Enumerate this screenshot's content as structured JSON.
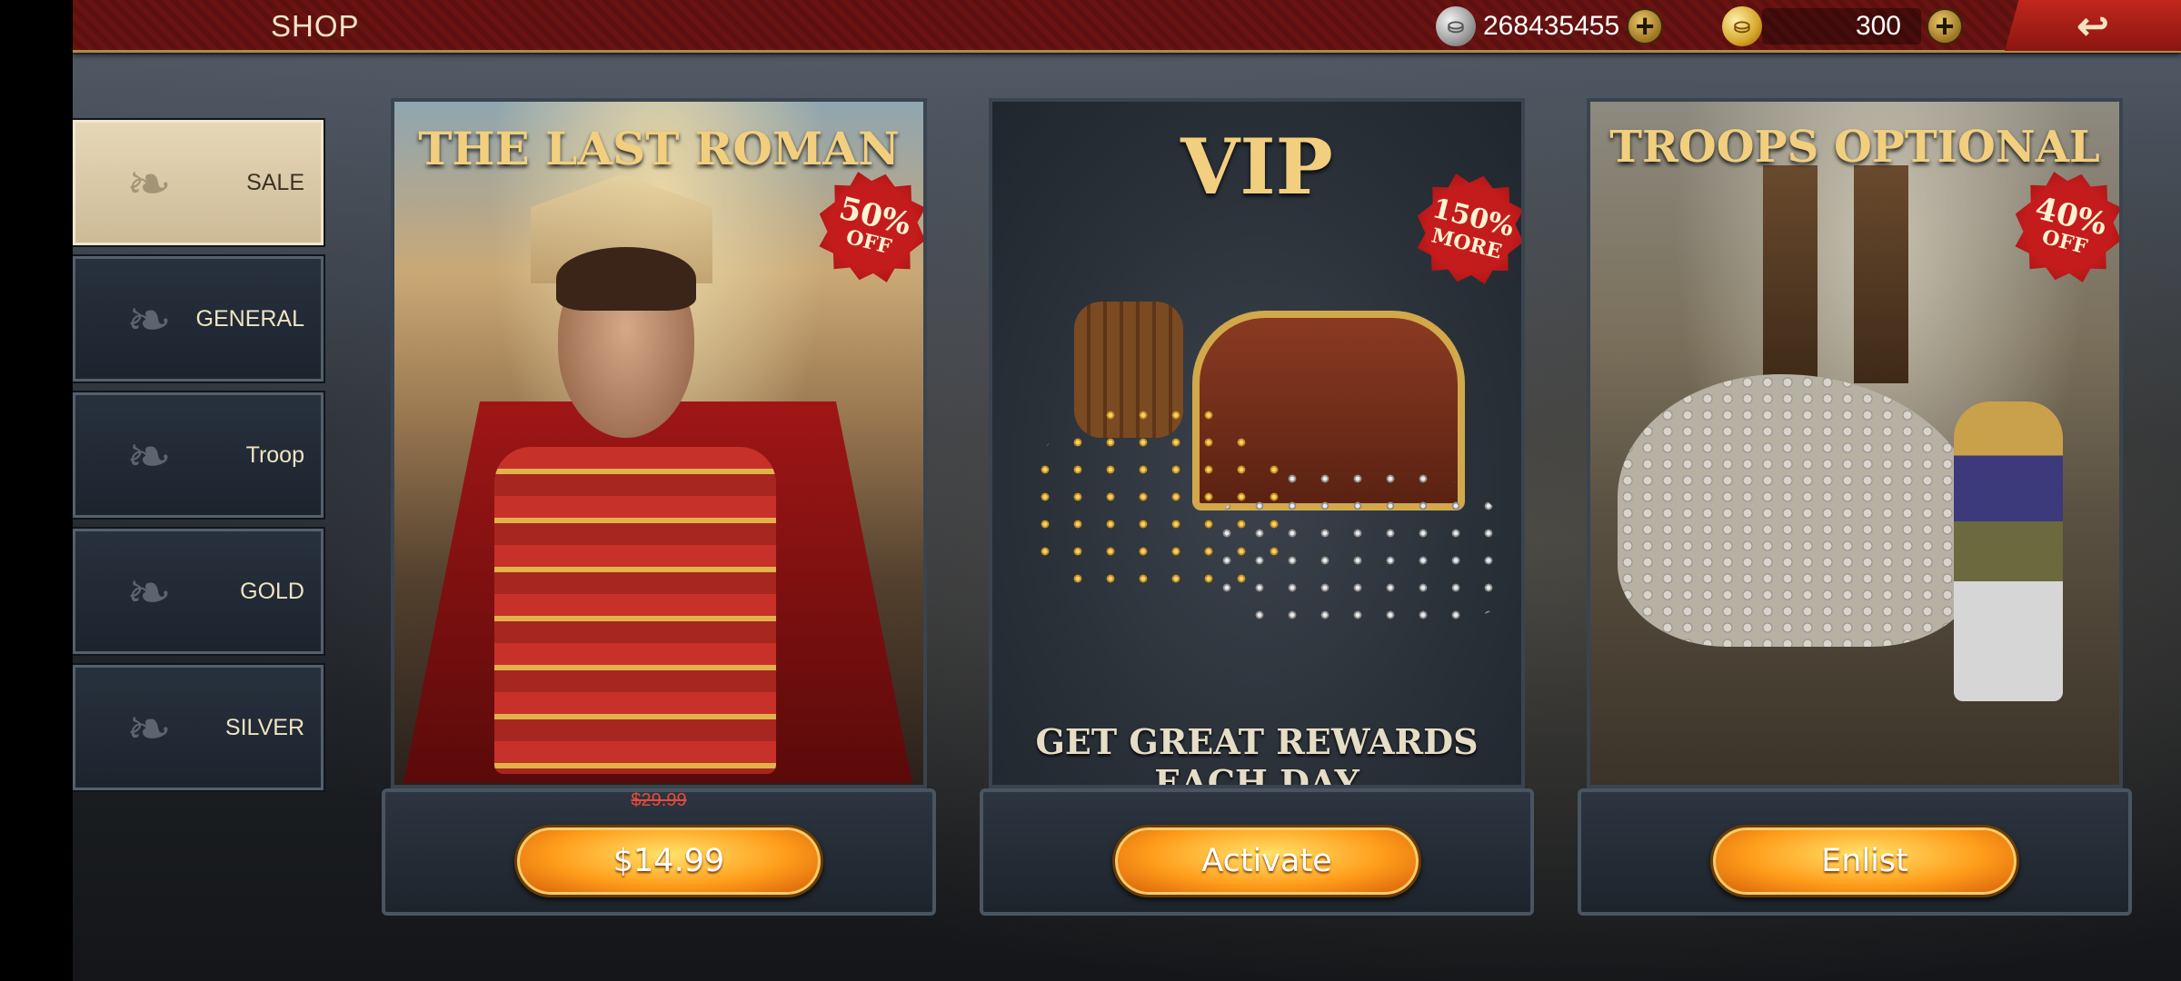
{
  "topbar": {
    "title": "SHOP",
    "silver_amount": "268435455",
    "gold_amount": "300",
    "silver_icon": "silver-coin-icon",
    "gold_icon": "gold-coin-icon",
    "plus_icon": "plus-icon",
    "back_icon": "back-arrow-icon"
  },
  "sidebar": {
    "items": [
      {
        "label": "SALE",
        "active": true
      },
      {
        "label": "GENERAL",
        "active": false
      },
      {
        "label": "Troop",
        "active": false
      },
      {
        "label": "GOLD",
        "active": false
      },
      {
        "label": "SILVER",
        "active": false
      }
    ]
  },
  "cards": [
    {
      "title": "THE LAST ROMAN",
      "badge_big": "50%",
      "badge_small": "OFF",
      "old_price": "$29.99",
      "button_label": "$14.99"
    },
    {
      "title": "VIP",
      "badge_big": "150%",
      "badge_small": "MORE",
      "caption": "GET GREAT REWARDS EACH DAY",
      "button_label": "Activate"
    },
    {
      "title": "TROOPS OPTIONAL",
      "badge_big": "40%",
      "badge_small": "OFF",
      "button_label": "Enlist"
    }
  ],
  "colors": {
    "accent_gold": "#f1cf7f",
    "topbar_red": "#6a1412",
    "badge_red": "#c41c1c",
    "button_orange": "#ff9c1a"
  }
}
